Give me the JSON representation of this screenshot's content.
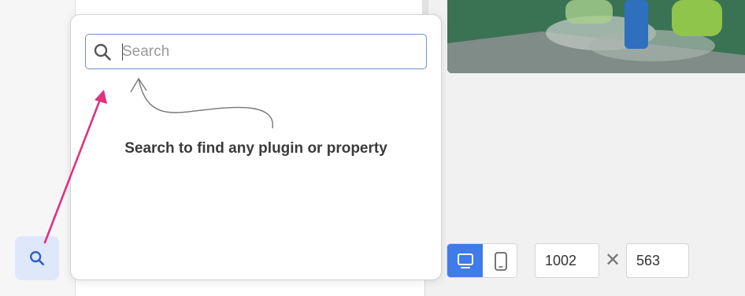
{
  "search": {
    "placeholder": "Search",
    "hint": "Search to find any plugin or property"
  },
  "icons": {
    "sidebar_search": "search-icon",
    "field_search": "search-icon",
    "desktop": "desktop-icon",
    "mobile": "mobile-icon",
    "times": "times-icon"
  },
  "viewport": {
    "width": "1002",
    "height": "563",
    "times_symbol": "✕"
  },
  "colors": {
    "accent": "#3f7be9",
    "annotation_arrow": "#e2307f",
    "sidebar_button_bg": "#dfe8fa"
  }
}
